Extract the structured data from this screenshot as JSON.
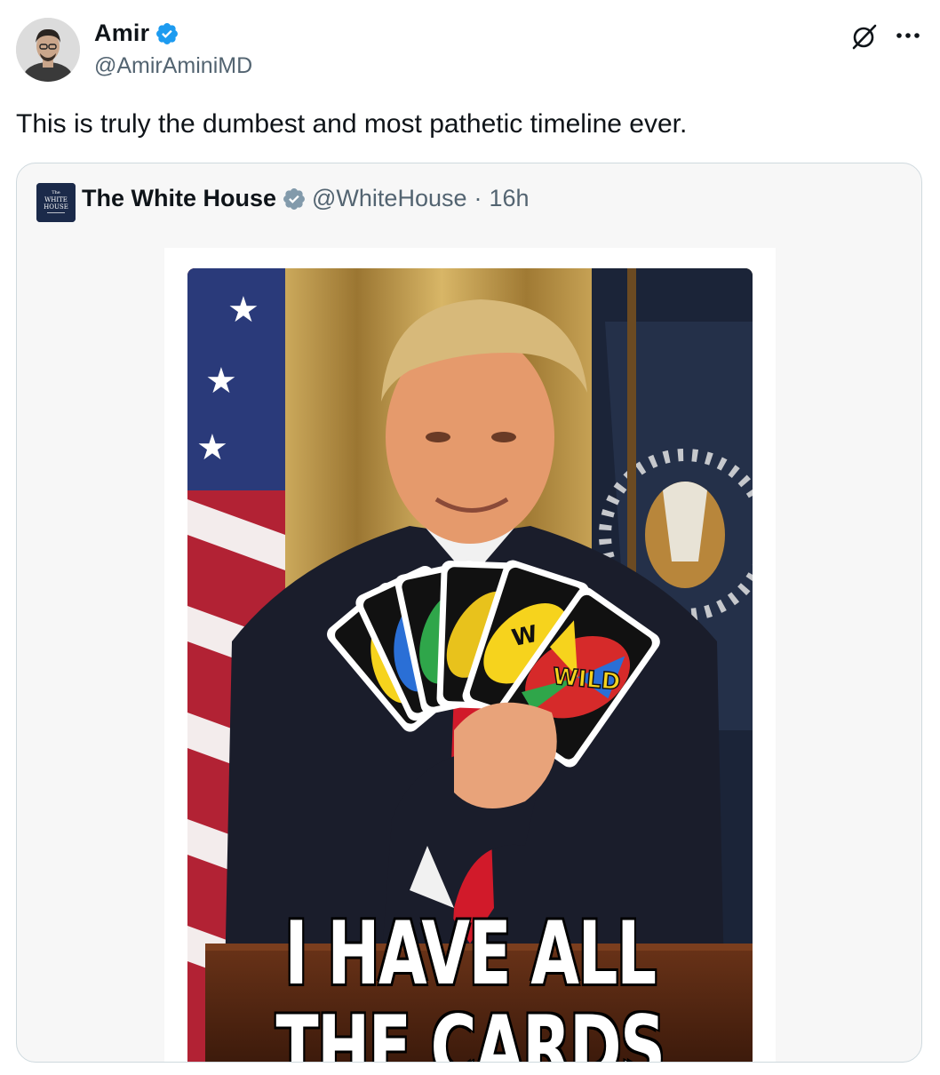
{
  "author": {
    "display_name": "Amir",
    "handle": "@AmirAminiMD",
    "verified": true,
    "avatar_icon": "profile-photo"
  },
  "header_actions": {
    "grok_icon": "grok-icon",
    "more_icon": "more-icon"
  },
  "tweet": {
    "text": "This is truly the dumbest and most pathetic timeline ever."
  },
  "quoted_tweet": {
    "display_name": "The White House",
    "handle": "@WhiteHouse",
    "separator": "·",
    "time": "16h",
    "verified_color": "#829aab",
    "avatar_text": [
      "The",
      "WHITE",
      "HOUSE"
    ],
    "media": {
      "caption_line1": "I HAVE ALL",
      "caption_line2": "THE CARDS",
      "card_label_wild": "WILD",
      "card_label_w": "W"
    }
  },
  "colors": {
    "verified_blue": "#1d9bf0",
    "text_secondary": "#536471",
    "card_border": "#cfd9de"
  }
}
